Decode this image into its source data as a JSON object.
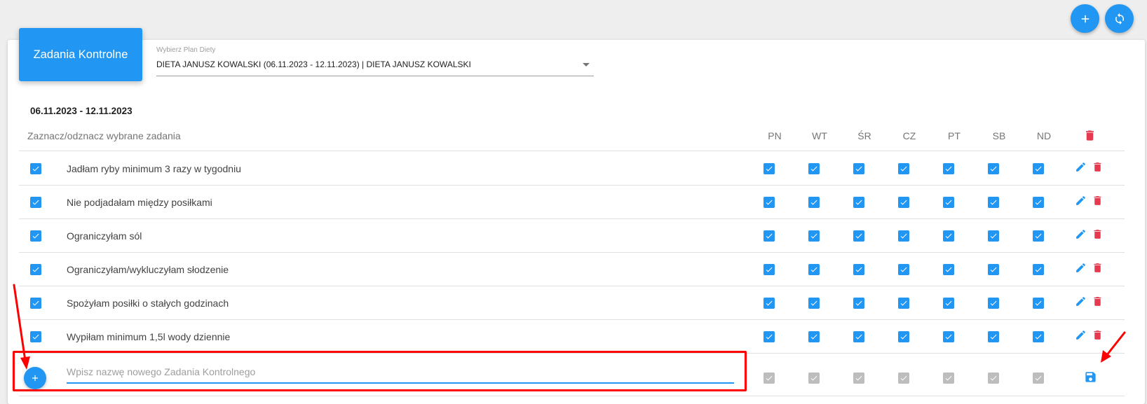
{
  "top_actions": {
    "add_icon": "plus-icon",
    "refresh_icon": "refresh-icon"
  },
  "header": {
    "badge_title": "Zadania Kontrolne"
  },
  "diet_select": {
    "label": "Wybierz Plan Diety",
    "value": "DIETA JANUSZ KOWALSKI (06.11.2023 - 12.11.2023) | DIETA JANUSZ KOWALSKI"
  },
  "date_range": "06.11.2023 - 12.11.2023",
  "table": {
    "hint": "Zaznacz/odznacz wybrane zadania",
    "days": [
      "PN",
      "WT",
      "ŚR",
      "CZ",
      "PT",
      "SB",
      "ND"
    ],
    "rows": [
      {
        "label": "Jadłam ryby minimum 3 razy w tygodniu",
        "selected": true,
        "days": [
          true,
          true,
          true,
          true,
          true,
          true,
          true
        ]
      },
      {
        "label": "Nie podjadałam między posiłkami",
        "selected": true,
        "days": [
          true,
          true,
          true,
          true,
          true,
          true,
          true
        ]
      },
      {
        "label": "Ograniczyłam sól",
        "selected": true,
        "days": [
          true,
          true,
          true,
          true,
          true,
          true,
          true
        ]
      },
      {
        "label": "Ograniczyłam/wykluczyłam słodzenie",
        "selected": true,
        "days": [
          true,
          true,
          true,
          true,
          true,
          true,
          true
        ]
      },
      {
        "label": "Spożyłam posiłki o stałych godzinach",
        "selected": true,
        "days": [
          true,
          true,
          true,
          true,
          true,
          true,
          true
        ]
      },
      {
        "label": "Wypiłam minimum 1,5l wody dziennie",
        "selected": true,
        "days": [
          true,
          true,
          true,
          true,
          true,
          true,
          true
        ]
      }
    ]
  },
  "new_task": {
    "placeholder": "Wpisz nazwę nowego Zadania Kontrolnego",
    "value": "",
    "days_enabled": false
  },
  "colors": {
    "primary": "#2196f3",
    "danger": "#e53950",
    "annotation": "#ff0000"
  }
}
